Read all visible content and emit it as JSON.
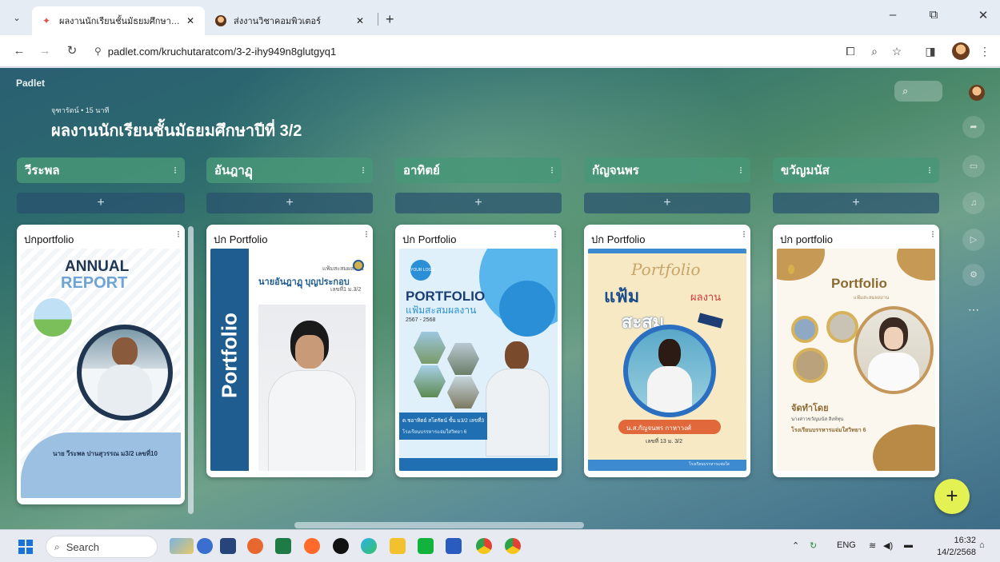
{
  "browser": {
    "tabs": [
      {
        "title": "ผลงานนักเรียนชั้นมัธยมศึกษาปีที่ 3/2",
        "close": "✕"
      },
      {
        "title": "ส่งงานวิชาคอมพิวเตอร์",
        "close": "✕"
      }
    ],
    "new_tab": "+",
    "url": "padlet.com/kruchutaratcom/3-2-ihy949n8glutgyq1"
  },
  "padlet": {
    "brand": "Padlet",
    "meta": "จุฑารัตน์ • 15 นาที",
    "title": "ผลงานนักเรียนชั้นมัธยมศึกษาปีที่ 3/2",
    "add_symbol": "+",
    "columns": [
      {
        "name": "วีระพล",
        "card_title": "ปกportfolio"
      },
      {
        "name": "อันฎาฏุ",
        "card_title": "ปก Portfolio"
      },
      {
        "name": "อาทิตย์",
        "card_title": "ปก Portfolio"
      },
      {
        "name": "กัญจนพร",
        "card_title": "ปก Portfolio"
      },
      {
        "name": "ขวัญมนัส",
        "card_title": "ปก portfolio"
      }
    ]
  },
  "posters": {
    "p1": {
      "heading1": "ANNUAL",
      "heading2": "REPORT",
      "caption": "นาย วีระพล ปานสุวรรณ ม3/2 เลขที่10"
    },
    "p2": {
      "vertical": "Portfolio",
      "sub": "แฟ้มสะสมผลงาน",
      "name": "นายอันฎาฏุ บุญประกอบ",
      "num": "เลขที่1 ม.3/2"
    },
    "p3": {
      "logo": "YOUR LOGO",
      "heading": "PORTFOLIO",
      "sub": "แฟ้มสะสมผลงาน",
      "years": "2567 - 2568",
      "caption": "ด.ชอาทิตย์ สโตรัตน์ ชั้น ม3/2 เลขที่3",
      "school": "โรงเรียนบรรหารแจ่มใสวิทยา 6"
    },
    "p4": {
      "script": "Portfolio",
      "word1": "แฟ้ม",
      "word2": "ผลงาน",
      "word3": "สะสม",
      "name": "น.ส.กัญจนพร กาหาวงศ์",
      "num": "เลขที่ 13 ม. 3/2",
      "footer": "โรงเรียนบรรหารแจ่มใส"
    },
    "p5": {
      "heading": "Portfolio",
      "sub": "แฟ้มสะสมผลงาน",
      "made_by": "จัดทำโดย",
      "name": "นางสาวขวัญมนัส สิงห์ทุน",
      "school": "โรงเรียนบรรหารแจ่มใสวิทยา 6"
    }
  },
  "taskbar": {
    "search": "Search",
    "lang": "ENG",
    "time": "16:32",
    "date": "14/2/2568"
  },
  "colors": {
    "column_header": "#4c9678",
    "fab": "#e4f152",
    "accent_blue": "#1f6fb2"
  }
}
